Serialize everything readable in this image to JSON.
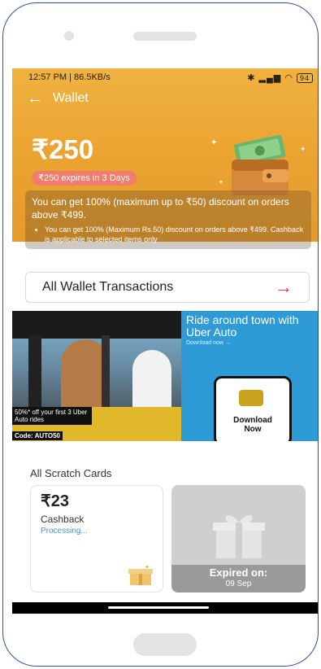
{
  "status_bar": {
    "left": "12:57 PM | 86.5KB/s",
    "right": "94"
  },
  "nav": {
    "title": "Wallet"
  },
  "wallet": {
    "amount": "₹250",
    "expiry_text": "₹250 expires in 3 Days",
    "offer_main": "You can get 100% (maximum up to ₹50) discount on orders above ₹499.",
    "offer_detail": "You can get 100% (Maximum Rs.50) discount on orders above ₹499. Cashback is applicable to selected items only"
  },
  "transactions": {
    "label": "All Wallet Transactions"
  },
  "banner": {
    "headline": "Ride around town with Uber Auto",
    "subtext": "Download now →",
    "promo": "50%* off your first 3 Uber Auto rides",
    "code": "Code: AUTO50",
    "cta": "Download Now"
  },
  "scratch": {
    "title": "All Scratch Cards",
    "card1": {
      "amount": "₹23",
      "label": "Cashback",
      "status": "Processing..."
    },
    "card2": {
      "expired_label": "Expired on:",
      "date": "09 Sep"
    }
  },
  "colors": {
    "accent": "#e0265c",
    "header": "#eaa230",
    "badge": "#f07b6e",
    "status_blue": "#4a90d9"
  }
}
